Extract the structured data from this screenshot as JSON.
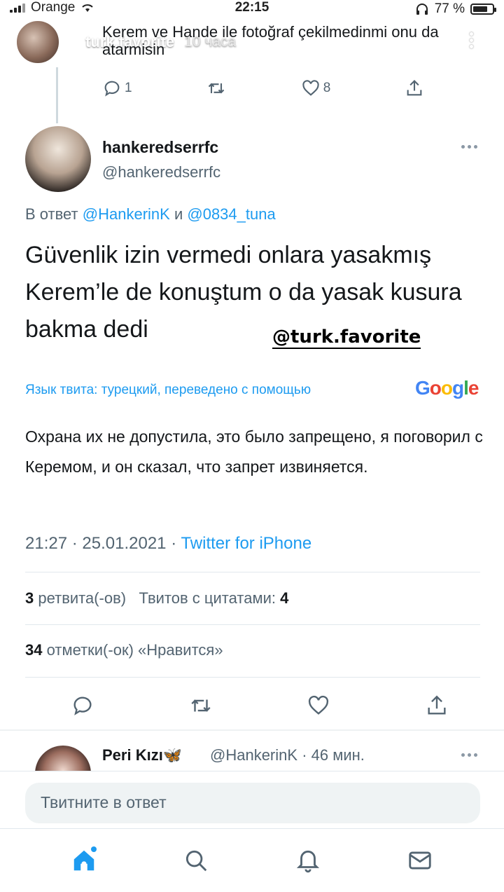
{
  "status_bar": {
    "carrier": "Orange",
    "time": "22:15",
    "battery": "77 %",
    "battery_level": 0.77
  },
  "story": {
    "username": "turk.favorite",
    "time_ago": "10 часа"
  },
  "parent_tweet": {
    "text": "Kerem ve Hande ile fotoğraf çekilmedinmi onu da atarmisin",
    "reply_count": "1",
    "like_count": "8"
  },
  "tweet": {
    "display_name": "hankeredserrfc",
    "handle": "@hankeredserrfc",
    "reply_prefix": "В ответ",
    "mention_1": "@HankerinK",
    "reply_joiner": "и",
    "mention_2": "@0834_tuna",
    "text": "Güvenlik izin vermedi onlara yasakmış Kerem’le de konuştum o da yasak kusura bakma dedi",
    "watermark": "@turk.favorite",
    "translation_note": "Язык твита: турецкий, переведено с помощью",
    "translation_provider": "Google",
    "translation": "Охрана их не допустила, это было запрещено, я поговорил с Керемом, и он сказал, что запрет извиняется.",
    "time": "21:27",
    "date": "25.01.2021",
    "separator": "·",
    "source": "Twitter for iPhone",
    "retweets_count": "3",
    "retweets_label": "ретвита(-ов)",
    "quotes_label": "Твитов с цитатами:",
    "quotes_count": "4",
    "likes_count": "34",
    "likes_label": "отметки(-ок) «Нравится»"
  },
  "next_reply": {
    "display_name": "Peri Kızı",
    "name_emoji": "🦋",
    "handle": "@HankerinK",
    "time_ago": "· 46 мин."
  },
  "composer": {
    "placeholder": "Твитните в ответ"
  },
  "colors": {
    "accent": "#1d9bf0",
    "secondary_text": "#536471",
    "primary_text": "#14171a"
  },
  "icons": {
    "nav": [
      "home-icon",
      "search-icon",
      "bell-icon",
      "mail-icon"
    ],
    "actions": [
      "reply-icon",
      "retweet-icon",
      "like-icon",
      "share-icon"
    ]
  }
}
